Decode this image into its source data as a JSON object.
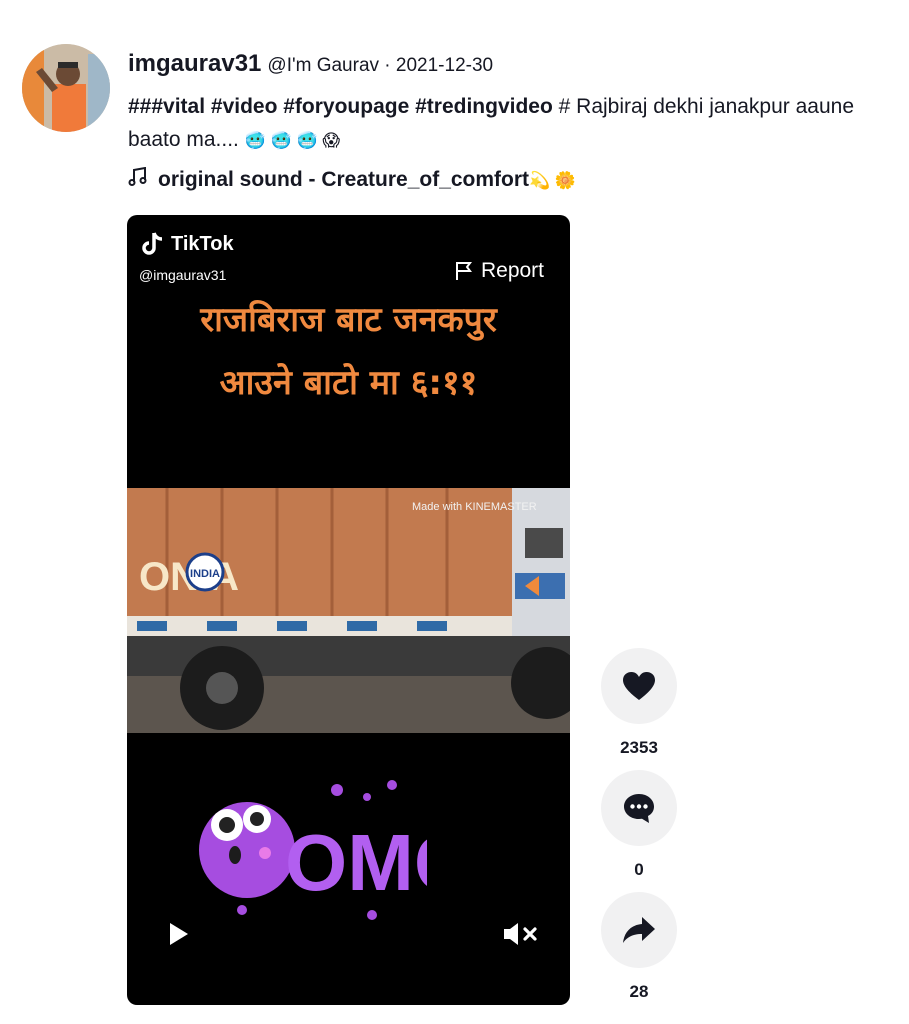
{
  "post": {
    "username": "imgaurav31",
    "nickname": "@I'm Gaurav",
    "separator": " · ",
    "date": "2021-12-30",
    "caption_tags": "###vital #video #foryoupage #tredingvideo",
    "caption_text": " # Rajbiraj dekhi janakpur aaune baato ma.... ",
    "caption_emojis": "🥶 🥶 🥶 😱",
    "music": "original sound - Creature_of_comfort",
    "music_emojis": "💫 🌼"
  },
  "player": {
    "brand": "TikTok",
    "handle": "@imgaurav31",
    "report_label": "Report",
    "overlay_line1": "राजबिराज बाट जनकपुर",
    "overlay_line2": "आउने बाटो मा ६:११",
    "truck_text": "ONIA",
    "truck_badge": "INDIA",
    "watermark": "Made with KINEMASTER",
    "sticker_text": "OMG"
  },
  "actions": {
    "likes": "2353",
    "comments": "0",
    "shares": "28"
  },
  "colors": {
    "overlay_text": "#f0893f",
    "action_bg": "#f1f1f2",
    "text_primary": "#161823"
  }
}
